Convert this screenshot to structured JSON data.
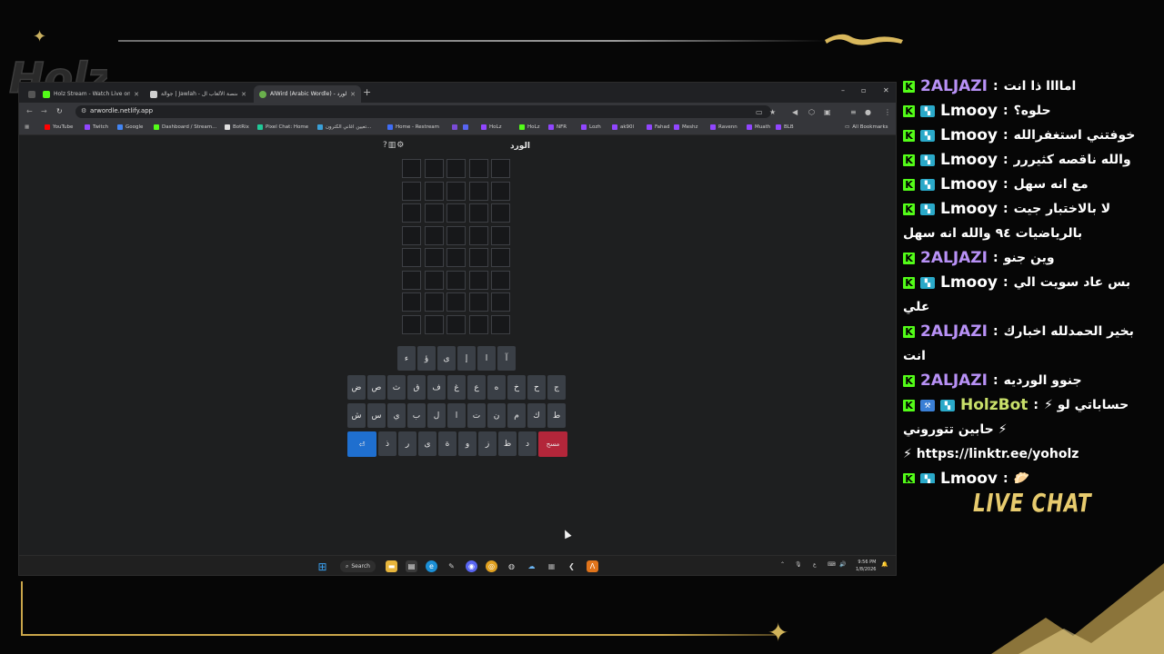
{
  "overlay": {
    "logo_text": "Holz",
    "live_chat_label": "LIVE CHAT",
    "accent_color": "#caa64a"
  },
  "browser": {
    "tabs": [
      {
        "label": "Holz Stream - Watch Live on Ki",
        "favicon": "kick-icon",
        "color": "#53fc18"
      },
      {
        "label": "جوالة | Jawlah - منصة الألعاب ال",
        "favicon": "jawlah-icon",
        "color": "#d0d0d0"
      },
      {
        "label": "AlWird (Arabic Wordle) - الورد",
        "favicon": "alwird-icon",
        "color": "#6ab04c"
      }
    ],
    "new_tab": "+",
    "window_controls": {
      "minimize": "–",
      "maximize": "▫",
      "close": "✕"
    },
    "url": "arwordle.netlify.app",
    "bookmarks": [
      {
        "label": "YouTube",
        "color": "#ff0000"
      },
      {
        "label": "Twitch",
        "color": "#9146ff"
      },
      {
        "label": "Google",
        "color": "#4285f4"
      },
      {
        "label": "Dashboard / Stream...",
        "color": "#53fc18"
      },
      {
        "label": "BotRix",
        "color": "#e0e0e0"
      },
      {
        "label": "Pixel Chat: Home",
        "color": "#20c997"
      },
      {
        "label": "تعيين اغاني الكترون...",
        "color": "#3aa0d8"
      },
      {
        "label": "Home - Restream",
        "color": "#3f6df5"
      },
      {
        "label": "",
        "color": "#7a4bd6"
      },
      {
        "label": "",
        "color": "#5865f2"
      },
      {
        "label": "HoLz",
        "color": "#9146ff"
      },
      {
        "label": "HoLz",
        "color": "#53fc18"
      },
      {
        "label": "NFR",
        "color": "#9146ff"
      },
      {
        "label": "Lozh",
        "color": "#9146ff"
      },
      {
        "label": "ak90l",
        "color": "#9146ff"
      },
      {
        "label": "Fahad",
        "color": "#9146ff"
      },
      {
        "label": "Meshz",
        "color": "#9146ff"
      },
      {
        "label": "Ravenn",
        "color": "#9146ff"
      },
      {
        "label": "Muath",
        "color": "#9146ff"
      },
      {
        "label": "BLB",
        "color": "#9146ff"
      }
    ],
    "all_bookmarks": "All Bookmarks"
  },
  "game": {
    "title": "الورد",
    "icons": [
      "help-icon",
      "stats-icon",
      "settings-icon"
    ],
    "rows": 8,
    "cols": 5,
    "keyboard": {
      "row1": [
        "آ",
        "ا",
        "إ",
        "ى",
        "ؤ",
        "ء"
      ],
      "row2": [
        "ج",
        "ح",
        "خ",
        "ه",
        "ع",
        "غ",
        "ف",
        "ق",
        "ث",
        "ص",
        "ض"
      ],
      "row3": [
        "ط",
        "ك",
        "م",
        "ن",
        "ت",
        "ا",
        "ل",
        "ب",
        "ي",
        "س",
        "ش"
      ],
      "row4": [
        "مسح",
        "د",
        "ظ",
        "ز",
        "و",
        "ة",
        "ى",
        "ر",
        "ذ",
        "⏎"
      ]
    }
  },
  "taskbar": {
    "search_label": "Search",
    "time": "9:56 PM",
    "date": "1/8/2026",
    "lang": "ع"
  },
  "chat": {
    "messages": [
      {
        "user": "2ALJAZI",
        "color": "#b891f6",
        "badges": [
          "kick"
        ],
        "lines": [
          "اماااا ذا انت"
        ]
      },
      {
        "user": "Lmooy",
        "color": "#ffffff",
        "badges": [
          "kick",
          "sub"
        ],
        "lines": [
          "حلوه؟"
        ]
      },
      {
        "user": "Lmooy",
        "color": "#ffffff",
        "badges": [
          "kick",
          "sub"
        ],
        "lines": [
          "خوفتني استغفرالله"
        ]
      },
      {
        "user": "Lmooy",
        "color": "#ffffff",
        "badges": [
          "kick",
          "sub"
        ],
        "lines": [
          "والله ناقصه كثيررر"
        ]
      },
      {
        "user": "Lmooy",
        "color": "#ffffff",
        "badges": [
          "kick",
          "sub"
        ],
        "lines": [
          "مع انه سهل"
        ]
      },
      {
        "user": "Lmooy",
        "color": "#ffffff",
        "badges": [
          "kick",
          "sub"
        ],
        "lines": [
          "لا بالاختبار جيت",
          "بالرياضيات ٩٤ والله انه سهل"
        ]
      },
      {
        "user": "2ALJAZI",
        "color": "#b891f6",
        "badges": [
          "kick"
        ],
        "lines": [
          "وين جنو"
        ]
      },
      {
        "user": "Lmooy",
        "color": "#ffffff",
        "badges": [
          "kick",
          "sub"
        ],
        "lines": [
          "بس عاد سويت الي",
          "علي"
        ]
      },
      {
        "user": "2ALJAZI",
        "color": "#b891f6",
        "badges": [
          "kick"
        ],
        "lines": [
          "بخير الحمدلله اخبارك",
          "انت"
        ]
      },
      {
        "user": "2ALJAZI",
        "color": "#b891f6",
        "badges": [
          "kick"
        ],
        "lines": [
          "جنوو الورديه"
        ]
      },
      {
        "user": "HolzBot",
        "color": "#c9e06a",
        "badges": [
          "kick",
          "mod",
          "sub"
        ],
        "lines": [
          "حساباتي لو ⚡",
          "⚡ حابين تتوروني",
          "https://linktr.ee/yoholz ⚡"
        ]
      },
      {
        "user": "Lmooy",
        "color": "#ffffff",
        "badges": [
          "kick",
          "sub"
        ],
        "lines": [
          "🥟"
        ]
      }
    ]
  }
}
